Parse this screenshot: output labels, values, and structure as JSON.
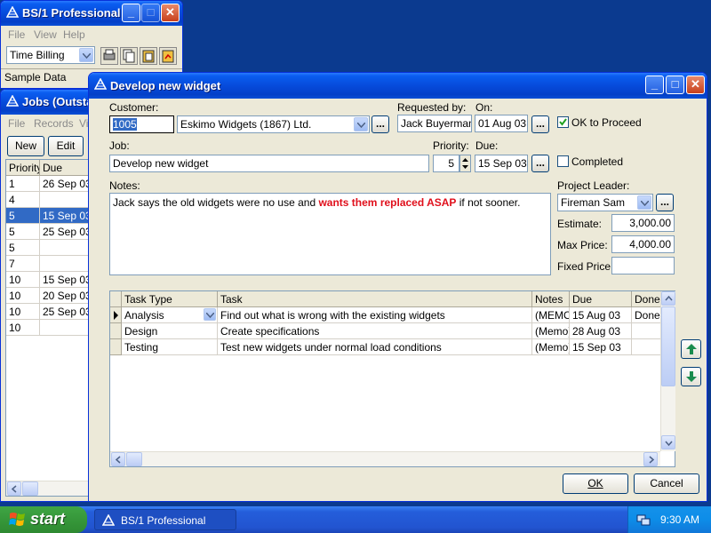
{
  "bg_window": {
    "title": "BS/1 Professional",
    "menu": [
      "File",
      "View",
      "Help"
    ],
    "combo_value": "Time Billing",
    "status": "Sample Data"
  },
  "jobs_window": {
    "title": "Jobs (Outsta",
    "menu": [
      "File",
      "Records",
      "Vi"
    ],
    "buttons": [
      "New",
      "Edit"
    ],
    "columns": [
      "Priority",
      "Due"
    ],
    "rows": [
      {
        "priority": "1",
        "due": "26 Sep 03"
      },
      {
        "priority": "4",
        "due": ""
      },
      {
        "priority": "5",
        "due": "15 Sep 03"
      },
      {
        "priority": "5",
        "due": "25 Sep 03"
      },
      {
        "priority": "5",
        "due": ""
      },
      {
        "priority": "7",
        "due": ""
      },
      {
        "priority": "10",
        "due": "15 Sep 03"
      },
      {
        "priority": "10",
        "due": "20 Sep 03"
      },
      {
        "priority": "10",
        "due": "25 Sep 03"
      },
      {
        "priority": "10",
        "due": ""
      }
    ],
    "selected_row": 2
  },
  "dialog": {
    "title": "Develop new widget",
    "labels": {
      "customer": "Customer:",
      "requested_by": "Requested by:",
      "on": "On:",
      "job": "Job:",
      "priority": "Priority:",
      "due": "Due:",
      "notes": "Notes:",
      "project_leader": "Project Leader:",
      "estimate": "Estimate:",
      "max_price": "Max Price:",
      "fixed_price": "Fixed Price:",
      "ok_to_proceed": "OK to Proceed",
      "completed": "Completed"
    },
    "customer_code": "1005",
    "customer_name": "Eskimo Widgets (1867) Ltd.",
    "requested_by": "Jack Buyerman",
    "on_date": "01 Aug 03",
    "ok_to_proceed": true,
    "job": "Develop new widget",
    "priority": "5",
    "due_date": "15 Sep 03",
    "completed": false,
    "notes": {
      "part1": "Jack says the old widgets were no use and ",
      "highlight": "wants them replaced ASAP",
      "part2": " if not sooner."
    },
    "project_leader": "Fireman Sam",
    "estimate": "3,000.00",
    "max_price": "4,000.00",
    "fixed_price": "",
    "ellipsis": "...",
    "tasks": {
      "columns": [
        "Task Type",
        "Task",
        "Notes",
        "Due",
        "Done"
      ],
      "rows": [
        {
          "type": "Analysis",
          "task": "Find out what is wrong with the existing widgets",
          "notes": "(MEMO",
          "due": "15 Aug 03",
          "done": "Done"
        },
        {
          "type": "Design",
          "task": "Create specifications",
          "notes": "(Memo)",
          "due": "28 Aug 03",
          "done": ""
        },
        {
          "type": "Testing",
          "task": "Test new widgets under normal load conditions",
          "notes": "(Memo)",
          "due": "15 Sep 03",
          "done": ""
        }
      ]
    },
    "ok_label": "OK",
    "cancel_label": "Cancel"
  },
  "taskbar": {
    "start_label": "start",
    "task_label": "BS/1 Professional",
    "clock": "9:30 AM"
  },
  "colors": {
    "highlight_text": "#e0101c",
    "selection": "#316ac5",
    "desktop": "#0b3a8f"
  }
}
